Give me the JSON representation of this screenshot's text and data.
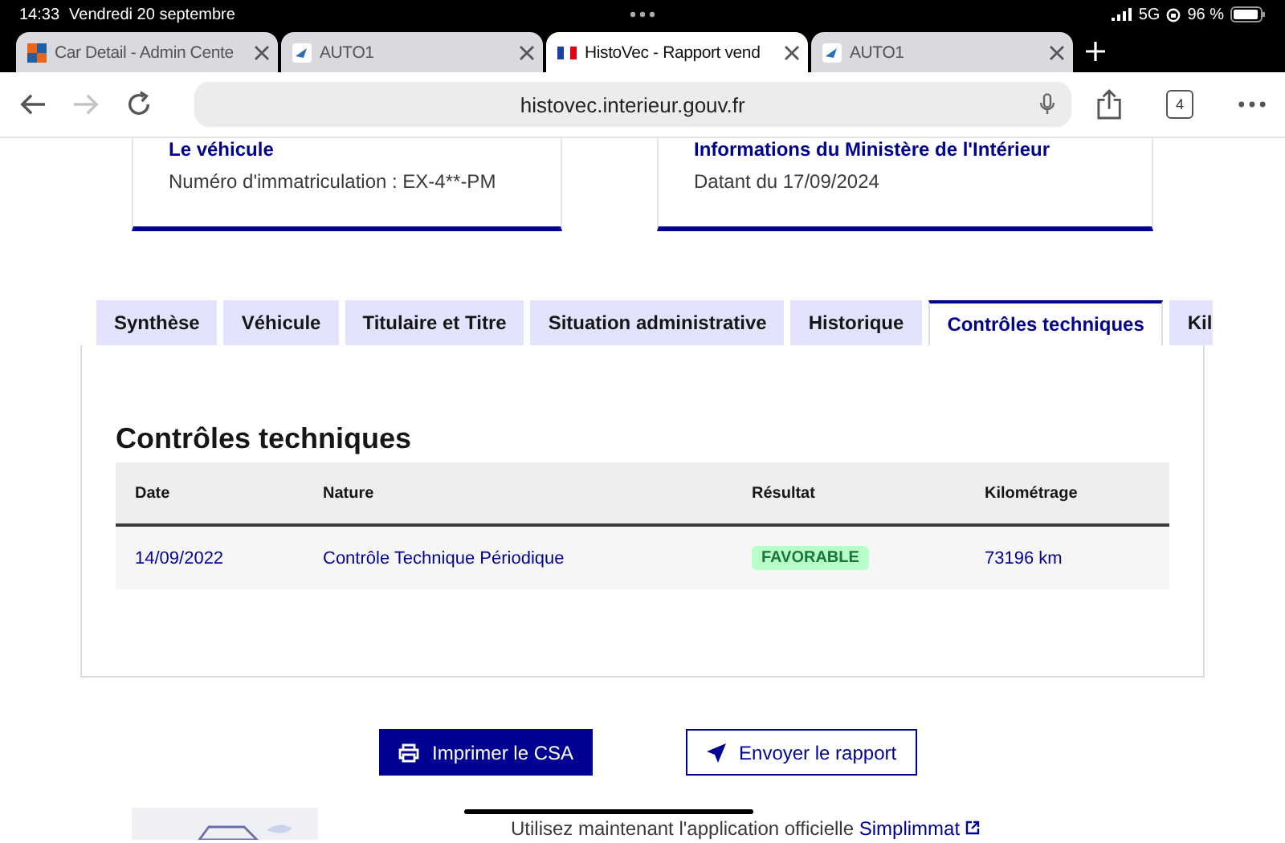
{
  "status_bar": {
    "time": "14:33",
    "date": "Vendredi 20 septembre",
    "network": "5G",
    "battery": "96 %"
  },
  "browser_tabs": [
    {
      "title": "Car Detail - Admin Cente",
      "selected": false
    },
    {
      "title": "AUTO1",
      "selected": false
    },
    {
      "title": "HistoVec - Rapport vend",
      "selected": true
    },
    {
      "title": "AUTO1",
      "selected": false
    }
  ],
  "toolbar": {
    "url": "histovec.interieur.gouv.fr",
    "tab_count": "4",
    "forward_disabled": true
  },
  "cards": [
    {
      "title": "Le véhicule",
      "text": "Numéro d'immatriculation : EX-4**-PM"
    },
    {
      "title": "Informations du Ministère de l'Intérieur",
      "text": "Datant du 17/09/2024"
    }
  ],
  "page_tabs": [
    {
      "label": "Synthèse",
      "selected": false
    },
    {
      "label": "Véhicule",
      "selected": false
    },
    {
      "label": "Titulaire et Titre",
      "selected": false
    },
    {
      "label": "Situation administrative",
      "selected": false
    },
    {
      "label": "Historique",
      "selected": false
    },
    {
      "label": "Contrôles techniques",
      "selected": true
    },
    {
      "label": "Kil",
      "selected": false
    }
  ],
  "section": {
    "heading": "Contrôles techniques",
    "table": {
      "columns": [
        "Date",
        "Nature",
        "Résultat",
        "Kilométrage"
      ],
      "rows": [
        {
          "date": "14/09/2022",
          "nature": "Contrôle Technique Périodique",
          "result": {
            "text": "FAVORABLE",
            "kind": "favorable"
          },
          "mileage": "73196 km"
        }
      ]
    }
  },
  "buttons": [
    {
      "label": "Imprimer le CSA",
      "kind": "primary"
    },
    {
      "label": "Envoyer le rapport",
      "kind": "secondary"
    }
  ],
  "footer": {
    "text": "Utilisez maintenant l'application officielle ",
    "link": "Simplimmat"
  }
}
